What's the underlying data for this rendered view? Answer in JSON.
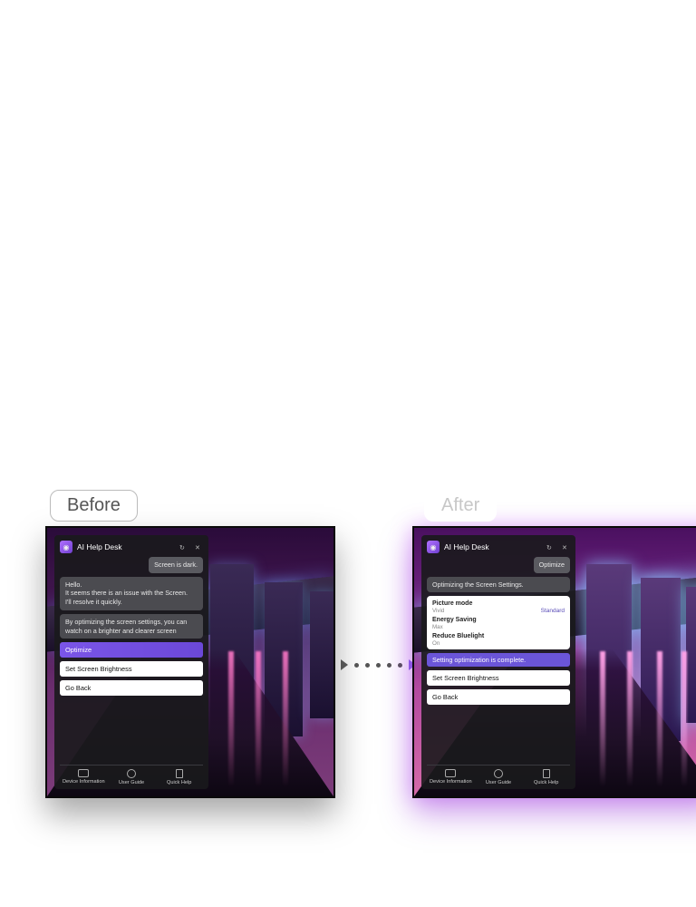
{
  "labels": {
    "before": "Before",
    "after": "After"
  },
  "panel": {
    "title": "AI Help Desk",
    "icons": {
      "app": "eye-ai-icon",
      "refresh": "↻",
      "close": "✕"
    }
  },
  "before": {
    "user_msg": "Screen is dark.",
    "bot_msg_1": [
      "Hello.",
      "It seems there is an issue with the Screen.",
      "I'll resolve it quickly."
    ],
    "bot_msg_2": [
      "By optimizing the screen settings, you can watch on a brighter and clearer screen"
    ],
    "actions": {
      "optimize": "Optimize",
      "brightness": "Set Screen Brightness",
      "back": "Go Back"
    }
  },
  "after": {
    "user_tag": "Optimize",
    "status_1": "Optimizing the Screen Settings.",
    "settings": {
      "picture_mode": {
        "label": "Picture mode",
        "value_old": "Vivid",
        "value_new": "Standard"
      },
      "energy_saving": {
        "label": "Energy Saving",
        "value": "Max"
      },
      "reduce_bluelight": {
        "label": "Reduce Bluelight",
        "value": "On"
      }
    },
    "status_2": "Setting optimization is complete.",
    "actions": {
      "brightness": "Set Screen Brightness",
      "back": "Go Back"
    }
  },
  "bottom_bar": {
    "device_info": "Device Information",
    "user_guide": "User Guide",
    "quick_help": "Quick Help"
  }
}
